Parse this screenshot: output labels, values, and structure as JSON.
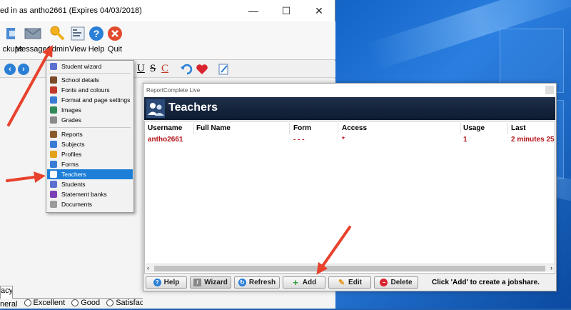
{
  "window": {
    "title": "ed in as antho2661 (Expires 04/03/2018)",
    "minimize": "—",
    "maximize": "☐",
    "close": "✕"
  },
  "toolbar": {
    "items": [
      {
        "label": "ckups",
        "icon": "backups-icon"
      },
      {
        "label": "Messages",
        "icon": "envelope-icon"
      },
      {
        "label": "Admin",
        "icon": "key-icon"
      },
      {
        "label": "View",
        "icon": "view-icon"
      },
      {
        "label": "Help",
        "icon": "help-icon"
      },
      {
        "label": "Quit",
        "icon": "quit-icon"
      }
    ]
  },
  "formatting": {
    "underline": "U",
    "strike": "S",
    "color": "C"
  },
  "admin_menu": {
    "items": [
      {
        "label": "Student wizard",
        "color": "#5a6fd0"
      },
      {
        "label": "School details",
        "color": "#7a4a2a"
      },
      {
        "label": "Fonts and colours",
        "color": "#c0392b"
      },
      {
        "label": "Format and page settings",
        "color": "#3a7bd5"
      },
      {
        "label": "Images",
        "color": "#2e8b57"
      },
      {
        "label": "Grades",
        "color": "#8a8a8a"
      },
      {
        "label": "Reports",
        "color": "#8b5a2b"
      },
      {
        "label": "Subjects",
        "color": "#3a7bd5"
      },
      {
        "label": "Profiles",
        "color": "#e3a21a"
      },
      {
        "label": "Forms",
        "color": "#3a7bd5"
      },
      {
        "label": "Teachers",
        "color": "#ffffff"
      },
      {
        "label": "Students",
        "color": "#5a6fd0"
      },
      {
        "label": "Statement banks",
        "color": "#7b3fb5"
      },
      {
        "label": "Documents",
        "color": "#9a9a9a"
      }
    ],
    "selected": "Teachers"
  },
  "main": {
    "tab_label": "acy",
    "radio_options": [
      "neral",
      "Excellent",
      "Good",
      "Satisfactor"
    ]
  },
  "dialog": {
    "window_title": "ReportComplete Live",
    "header": "Teachers",
    "columns": [
      "Username",
      "Full Name",
      "Form",
      "Access",
      "Usage",
      "Last"
    ],
    "rows": [
      {
        "username": "antho2661",
        "full_name": "",
        "form": "- - -",
        "access": "*",
        "usage": "1",
        "last": "2 minutes 25"
      }
    ],
    "buttons": {
      "help": "Help",
      "wizard": "Wizard",
      "refresh": "Refresh",
      "add": "Add",
      "edit": "Edit",
      "delete": "Delete"
    },
    "hint": "Click 'Add' to create a jobshare."
  },
  "colors": {
    "accent_red": "#e8412c",
    "selection_blue": "#1e7fd8",
    "header_dark": "#0d1b30",
    "data_red": "#b3161b"
  }
}
